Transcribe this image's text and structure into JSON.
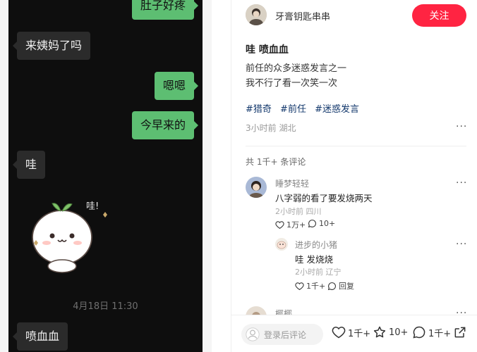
{
  "chat": {
    "messages": [
      {
        "side": "me",
        "text": "肚子好疼"
      },
      {
        "side": "other",
        "text": "来姨妈了吗"
      },
      {
        "side": "me",
        "text": "嗯嗯"
      },
      {
        "side": "me",
        "text": "今早来的"
      },
      {
        "side": "other",
        "text": "哇"
      },
      {
        "side": "other",
        "text": "喷血血"
      }
    ],
    "sticker_text": "哇!",
    "timestamp": "4月18日 11:30"
  },
  "note": {
    "author_name": "牙膏钥匙串串",
    "follow_label": "关注",
    "title": "哇 喷血血",
    "body_lines": [
      "前任的众多迷惑发言之一",
      "我不行了看一次笑一次"
    ],
    "tags": [
      "#猎奇",
      "#前任",
      "#迷惑发言"
    ],
    "meta": "3小时前 湖北",
    "comment_count": "共 1千+ 条评论"
  },
  "comments": [
    {
      "name": "睡梦轻轻",
      "text": "八字弱的看了要发烧两天",
      "meta": "2小时前 四川",
      "likes": "1万+",
      "replies": "10+"
    },
    {
      "name": "进步的小猪",
      "text": "哇 发烧烧",
      "meta": "2小时前 辽宁",
      "likes": "1千+",
      "reply_label": "回复"
    },
    {
      "name": "椰椰"
    }
  ],
  "bottom_bar": {
    "input_placeholder": "登录后评论",
    "likes": "1千+",
    "collects": "10+",
    "comments": "1千+"
  },
  "colors": {
    "accent": "#ff2442",
    "tag": "#13386c",
    "bubble_me": "#5dbe72",
    "bubble_other": "#2b2b2b"
  },
  "icons": [
    "heart-icon",
    "star-icon",
    "comment-icon",
    "share-icon",
    "more-dots-icon"
  ]
}
